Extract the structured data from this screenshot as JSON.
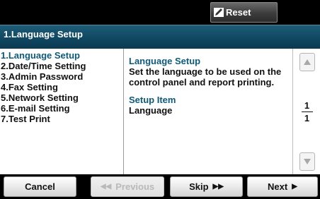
{
  "topbar": {
    "reset_label": "Reset"
  },
  "title": "1.Language Setup",
  "menu": {
    "items": [
      {
        "label": "1.Language Setup"
      },
      {
        "label": "2.Date/Time Setting"
      },
      {
        "label": "3.Admin Password"
      },
      {
        "label": "4.Fax Setting"
      },
      {
        "label": "5.Network Setting"
      },
      {
        "label": "6.E-mail Setting"
      },
      {
        "label": "7.Test Print"
      }
    ],
    "selected_index": 0
  },
  "description": {
    "heading": "Language Setup",
    "text_lines": [
      "Set the language to be used on the",
      "control panel and report printing."
    ],
    "setup_item_heading": "Setup Item",
    "setup_item_value": "Language"
  },
  "pager": {
    "current": "1",
    "total": "1"
  },
  "buttons": {
    "cancel": "Cancel",
    "previous": "Previous",
    "skip": "Skip",
    "next": "Next"
  },
  "colors": {
    "accent": "#0e5a7a",
    "titlebar": "#0f4660"
  },
  "icons": {
    "reset": "reset-pencil-icon",
    "previous": "double-chevron-left-icon",
    "skip": "double-chevron-right-icon",
    "next": "triangle-right-icon",
    "scroll_up": "triangle-up-icon",
    "scroll_down": "triangle-down-icon"
  }
}
